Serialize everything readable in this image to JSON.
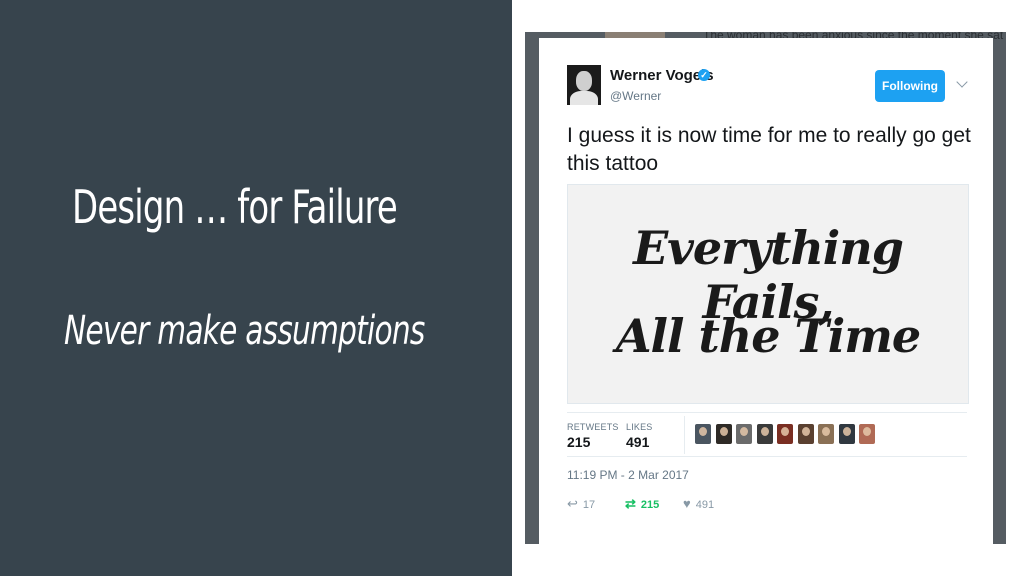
{
  "slide": {
    "title": "Design … for Failure",
    "subtitle": "Never make assumptions"
  },
  "background_snippet": "The woman has been anxious since the moment she sat",
  "tweet": {
    "author_name": "Werner Vogels",
    "verified": true,
    "handle": "@Werner",
    "follow_button": "Following",
    "text": "I guess it is now time for me to really go get this tattoo",
    "media": {
      "line1": "Everything Fails,",
      "line2": "All the Time"
    },
    "stats": {
      "retweets_label": "RETWEETS",
      "retweets": "215",
      "likes_label": "LIKES",
      "likes": "491"
    },
    "timestamp": "11:19 PM - 2 Mar 2017",
    "actions": {
      "reply_count": "17",
      "retweet_count": "215",
      "like_count": "491"
    }
  },
  "colors": {
    "slide_background": "#37444d",
    "twitter_blue": "#1da1f2",
    "retweet_green": "#17bf63"
  },
  "icons": [
    "verified-badge-icon",
    "chevron-down-icon",
    "reply-icon",
    "retweet-icon",
    "heart-icon"
  ]
}
